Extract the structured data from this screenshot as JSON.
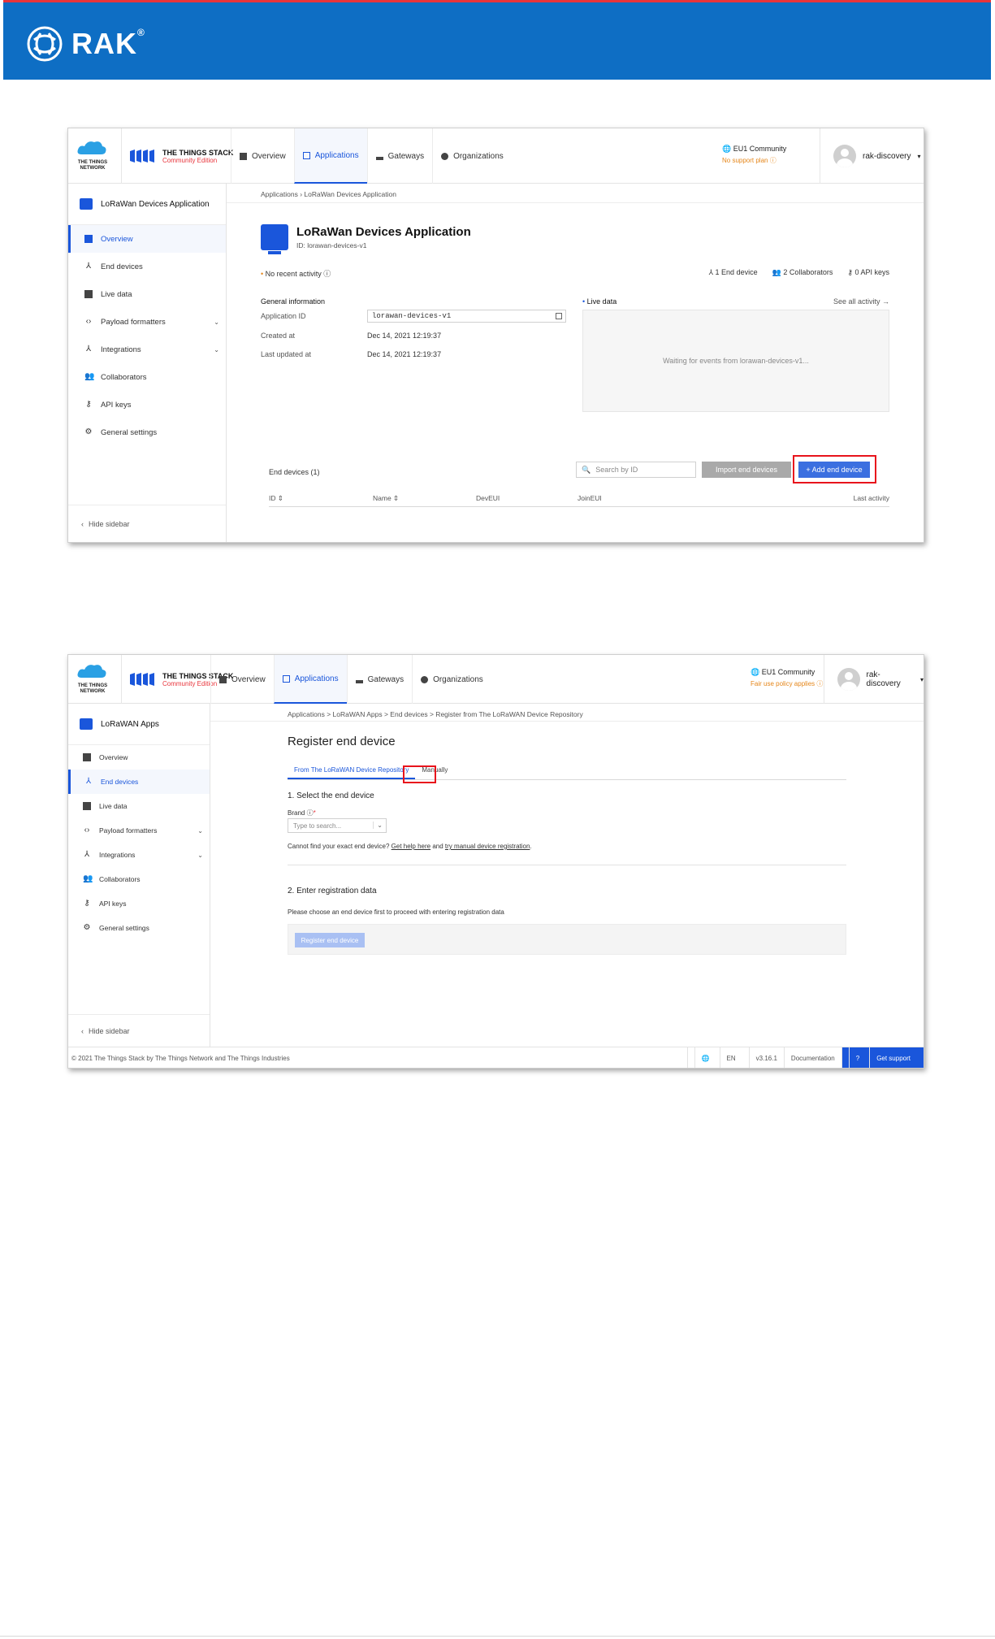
{
  "page": {
    "brand": "RAK",
    "brand_mark": "®"
  },
  "shot1": {
    "ttn_logo_text": "THE THINGS NETWORK",
    "stack_line1": "THE THINGS STACK",
    "stack_line2": "Community Edition",
    "nav": [
      "Overview",
      "Applications",
      "Gateways",
      "Organizations"
    ],
    "region": "EU1 Community",
    "region_sub": "No support plan",
    "user": "rak-discovery",
    "sidebar_app": "LoRaWan Devices Application",
    "sidebar_items": [
      "Overview",
      "End devices",
      "Live data",
      "Payload formatters",
      "Integrations",
      "Collaborators",
      "API keys",
      "General settings"
    ],
    "hide_sidebar": "Hide sidebar",
    "breadcrumb": "Applications  ›  LoRaWan Devices Application",
    "app_title": "LoRaWan Devices Application",
    "app_id_line": "ID: lorawan-devices-v1",
    "activity": "No recent activity",
    "stats": [
      "1 End device",
      "2 Collaborators",
      "0 API keys"
    ],
    "general_info": "General information",
    "rows": [
      {
        "label": "Application ID",
        "value": "lorawan-devices-v1"
      },
      {
        "label": "Created at",
        "value": "Dec 14, 2021 12:19:37"
      },
      {
        "label": "Last updated at",
        "value": "Dec 14, 2021 12:19:37"
      }
    ],
    "live_data": "Live data",
    "see_all": "See all activity →",
    "waiting": "Waiting for events from lorawan-devices-v1...",
    "end_devices_title": "End devices (1)",
    "search_placeholder": "Search by ID",
    "import_btn": "Import end devices",
    "add_btn": "+ Add end device",
    "columns": [
      "ID ⇕",
      "Name ⇕",
      "DevEUI",
      "JoinEUI",
      "Last activity"
    ]
  },
  "shot2": {
    "nav": [
      "Overview",
      "Applications",
      "Gateways",
      "Organizations"
    ],
    "region": "EU1 Community",
    "region_sub": "Fair use policy applies",
    "user": "rak-discovery",
    "sidebar_app": "LoRaWAN Apps",
    "sidebar_items": [
      "Overview",
      "End devices",
      "Live data",
      "Payload formatters",
      "Integrations",
      "Collaborators",
      "API keys",
      "General settings"
    ],
    "hide_sidebar": "Hide sidebar",
    "breadcrumb": "Applications  >  LoRaWAN Apps  >  End devices  >  Register from The LoRaWAN Device Repository",
    "title": "Register end device",
    "tabs": [
      "From The LoRaWAN Device Repository",
      "Manually"
    ],
    "step1": "1. Select the end device",
    "brand_label": "Brand",
    "brand_placeholder": "Type to search...",
    "cannot_pre": "Cannot find your exact end device? ",
    "help_link": "Get help here",
    "cannot_mid": " and ",
    "manual_link": "try manual device registration",
    "cannot_post": ".",
    "step2": "2. Enter registration data",
    "choose_text": "Please choose an end device first to proceed with entering registration data",
    "register_btn": "Register end device",
    "footer_copy": "© 2021 The Things Stack by The Things Network and The Things Industries",
    "footer_lang": "EN",
    "footer_version": "v3.16.1",
    "footer_docs": "Documentation",
    "footer_support": "Get support"
  }
}
